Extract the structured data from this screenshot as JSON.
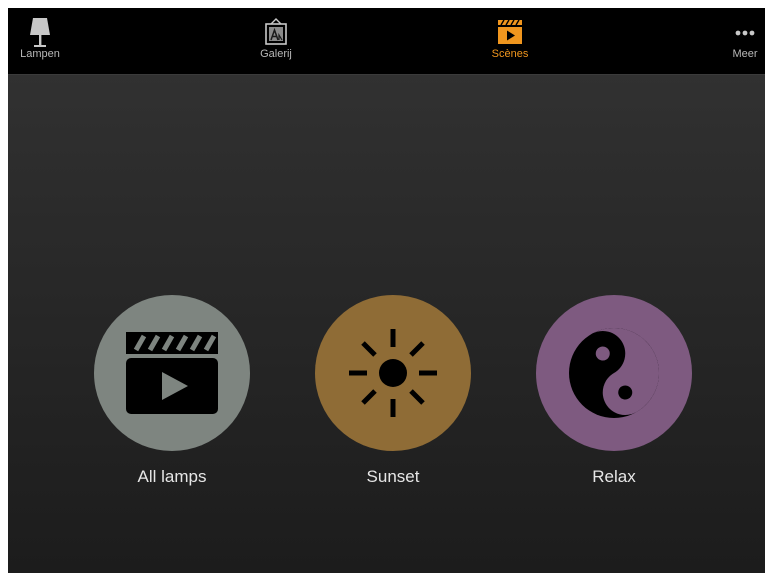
{
  "nav": {
    "tabs": [
      {
        "label": "Lampen",
        "icon": "lamp-icon",
        "active": false
      },
      {
        "label": "Galerij",
        "icon": "picture-icon",
        "active": false
      },
      {
        "label": "Scènes",
        "icon": "clapperboard-icon",
        "active": true
      },
      {
        "label": "Meer",
        "icon": "more-dots-icon",
        "active": false
      }
    ]
  },
  "scenes": [
    {
      "label": "All lamps",
      "icon": "clapperboard-icon",
      "color": "#7e8580"
    },
    {
      "label": "Sunset",
      "icon": "sun-icon",
      "color": "#8f6c36"
    },
    {
      "label": "Relax",
      "icon": "yin-yang-icon",
      "color": "#7e5a80"
    }
  ],
  "colors": {
    "active_tab": "#f0961e",
    "inactive_tab": "#b8b8b8",
    "topbar": "#000000"
  }
}
